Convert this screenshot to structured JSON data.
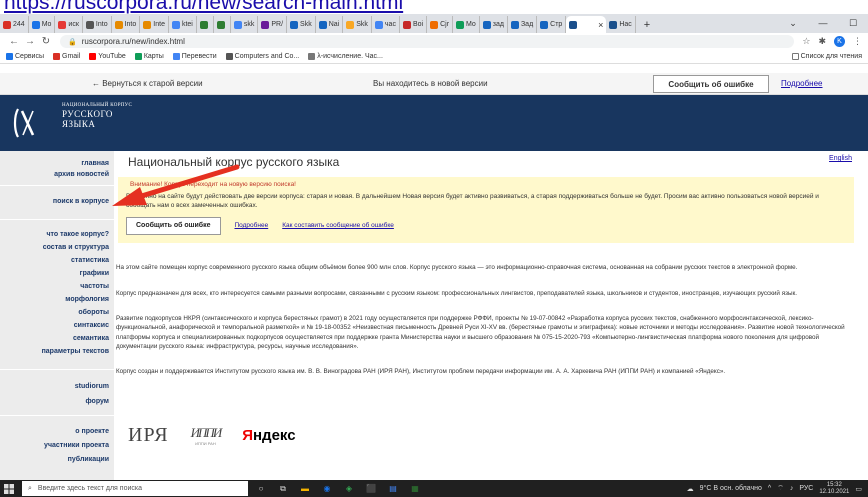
{
  "screenshot_title": "https://ruscorpora.ru/new/search-main.html",
  "browser": {
    "tabs": [
      {
        "label": "244",
        "color": "#d93025"
      },
      {
        "label": "Mo",
        "color": "#1a73e8"
      },
      {
        "label": "иск",
        "color": "#e53935"
      },
      {
        "label": "Into",
        "color": "#555555"
      },
      {
        "label": "Into",
        "color": "#e68a00"
      },
      {
        "label": "Inte",
        "color": "#e68a00"
      },
      {
        "label": "ktei",
        "color": "#4285f4"
      },
      {
        "label": "",
        "color": "#2e7d32"
      },
      {
        "label": "",
        "color": "#2e7d32"
      },
      {
        "label": "skk",
        "color": "#4285f4"
      },
      {
        "label": "PR/",
        "color": "#6a1b9a"
      },
      {
        "label": "Skk",
        "color": "#1565c0"
      },
      {
        "label": "Nai",
        "color": "#1565c0"
      },
      {
        "label": "Skk",
        "color": "#f9a825"
      },
      {
        "label": "час",
        "color": "#4285f4"
      },
      {
        "label": "Boi",
        "color": "#c62828"
      },
      {
        "label": "Cjr",
        "color": "#ef6c00"
      },
      {
        "label": "Mo",
        "color": "#0f9d58"
      },
      {
        "label": "зад",
        "color": "#1565c0"
      },
      {
        "label": "Зад",
        "color": "#1565c0"
      },
      {
        "label": "Стр",
        "color": "#1565c0"
      }
    ],
    "active_tab_label": "",
    "active_tab_color": "#1a4f8b",
    "next_tab_label": "Нас",
    "close_glyph": "×",
    "plus_glyph": "+",
    "url": "ruscorpora.ru/new/index.html",
    "profile_letter": "K",
    "bookmarks": [
      {
        "label": "Сервисы",
        "color": "#1a73e8"
      },
      {
        "label": "Gmail",
        "color": "#d93025"
      },
      {
        "label": "YouTube",
        "color": "#ff0000"
      },
      {
        "label": "Карты",
        "color": "#0f9d58"
      },
      {
        "label": "Перевести",
        "color": "#4285f4"
      },
      {
        "label": "Computers and Co...",
        "color": "#555555"
      },
      {
        "label": "λ-исчисление. Час...",
        "color": "#777777"
      }
    ],
    "reading_list": "Список для чтения"
  },
  "version_bar": {
    "back_link": "← Вернуться к старой версии",
    "new_version_text": "Вы находитесь в новой версии",
    "report_button": "Сообщить об ошибке",
    "more_link": "Подробнее"
  },
  "logo": {
    "line1": "НАЦИОНАЛЬНЫЙ КОРПУС",
    "line2": "РУССКОГО",
    "line3": "ЯЗЫКА"
  },
  "sidebar": {
    "main": "главная",
    "news": "архив новостей",
    "search": "поиск в корпусе",
    "what": "что такое корпус?",
    "structure": "состав и структура",
    "stats": "статистика",
    "graphs": "графики",
    "freq": "частоты",
    "morph": "морфология",
    "turns": "обороты",
    "syntax": "синтаксис",
    "semantics": "семантика",
    "params": "параметры текстов",
    "studiorum": "studiorum",
    "forum": "форум",
    "about": "о проекте",
    "participants": "участники проекта",
    "publications": "публикации"
  },
  "content": {
    "title": "Национальный корпус русского языка",
    "english": "English",
    "notice_warning": "Внимание! Корпус переходит на новую версию поиска!",
    "notice_body": "Временно на сайте будут действовать две версии корпуса: старая и новая. В дальнейшем Новая версия будет активно развиваться, а старая поддерживаться больше не будет. Просим вас активно пользоваться новой версией и сообщать нам о всех замеченных ошибках.",
    "notice_button": "Сообщить об ошибке",
    "notice_more": "Подробнее",
    "notice_howto": "Как составить сообщение об ошибке",
    "p1": "На этом сайте помещен корпус современного русского языка общим объёмом более 900 млн слов. Корпус русского языка — это информационно-справочная система, основанная на собрании русских текстов в электронной форме.",
    "p2": "Корпус предназначен для всех, кто интересуется самыми разными вопросами, связанными с русским языком: профессиональных лингвистов, преподавателей языка, школьников и студентов, иностранцев, изучающих русский язык.",
    "p3": "Развитие подкорпусов НКРЯ (синтаксического и корпуса берестяных грамот) в 2021 году осуществляется при поддержке РФФИ, проекты № 19-07-00842 «Разработка корпуса русских текстов, снабженного морфосинтаксической, лексико-функциональной, анафорической и темпоральной разметкой» и № 19-18-00352 «Неизвестная письменность Древней Руси XI-XV вв. (берестяные грамоты и эпиграфика): новые источники и методы исследования». Развитие новой технологической платформы корпуса и специализированных подкорпусов осуществляется при поддержке гранта Министерства науки и высшего образования № 075-15-2020-793 «Компьютерно-лингвистическая платформа нового поколения для цифровой документации русского языка: инфраструктура, ресурсы, научные исследования».",
    "p4": "Корпус создан и поддерживается Институтом русского языка им. В. В. Виноградова РАН (ИРЯ РАН), Институтом проблем передачи информации им. А. А. Харкевича РАН (ИППИ РАН) и компанией «Яндекс».",
    "partner_irya": "ИРЯ",
    "partner_ippi": "ИППИ",
    "partner_ippi_sub": "ИППИ РАН",
    "partner_yandex_y": "Я",
    "partner_yandex_rest": "ндекс"
  },
  "taskbar": {
    "search_placeholder": "Введите здесь текст для поиска",
    "weather": "9°C В осн. облачно",
    "lang": "РУС",
    "time": "15:32",
    "date": "12.10.2021"
  },
  "accent": "#18365f",
  "arrow_color": "#e53020"
}
